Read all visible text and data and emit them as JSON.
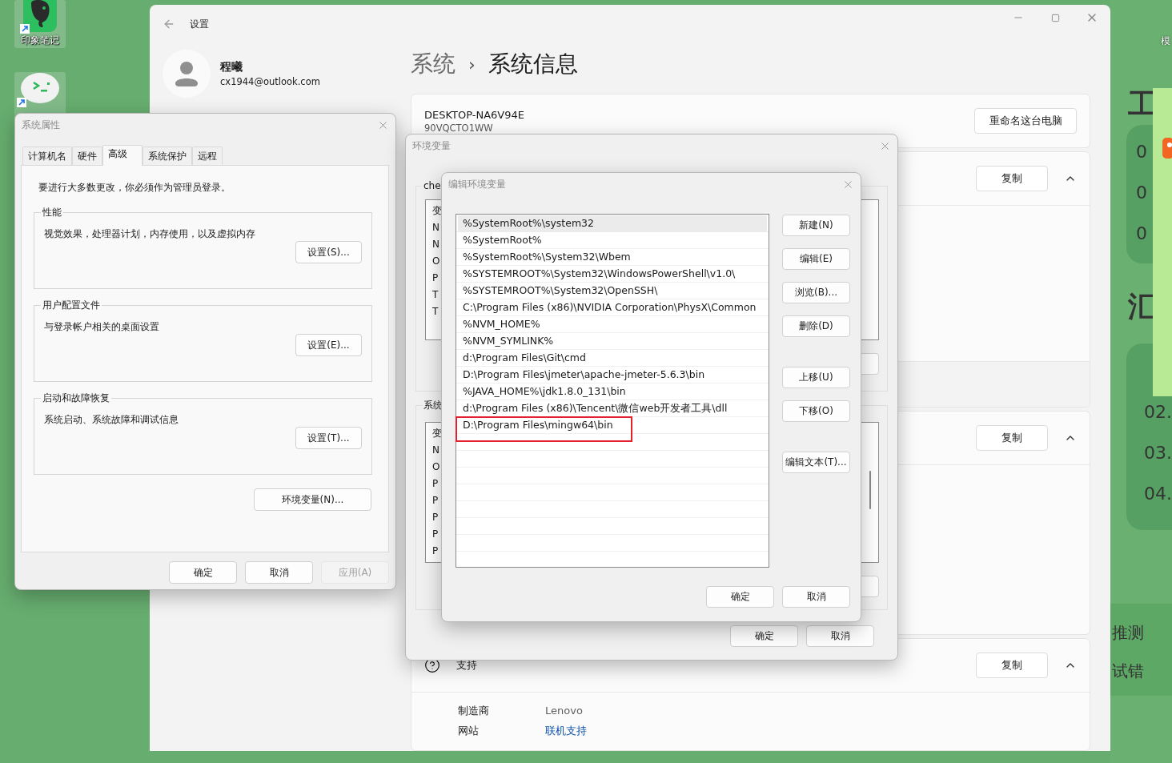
{
  "desktop": {
    "icons": [
      {
        "label": "印象笔记",
        "kind": "notes"
      },
      {
        "kind": "chat"
      }
    ]
  },
  "side_app": {
    "corner_label": "模",
    "title_1": "工",
    "numbers": [
      "0",
      "0",
      "0"
    ],
    "title_2": "汇",
    "steps": [
      "02.",
      "03.",
      "04."
    ],
    "notes": [
      "推测",
      "试错"
    ]
  },
  "settings": {
    "title": "设置",
    "user": {
      "name": "程曦",
      "email": "cx1944@outlook.com"
    },
    "breadcrumb": {
      "parent": "系统",
      "separator": "›",
      "current": "系统信息"
    },
    "device": {
      "name": "DESKTOP-NA6V94E",
      "model": "90VQCTO1WW",
      "rename_button": "重命名这台电脑"
    },
    "sections": [
      {
        "copy_button": "复制",
        "expanded": true
      },
      {
        "copy_button": "复制",
        "expanded": true
      },
      {
        "title": "支持",
        "copy_button": "复制",
        "expanded": true,
        "rows": [
          {
            "label": "制造商",
            "value": "Lenovo",
            "kind": "text"
          },
          {
            "label": "网站",
            "value": "联机支持",
            "kind": "link"
          }
        ]
      }
    ]
  },
  "system_properties": {
    "title": "系统属性",
    "tabs": [
      {
        "label": "计算机名",
        "selected": false
      },
      {
        "label": "硬件",
        "selected": false
      },
      {
        "label": "高级",
        "selected": true
      },
      {
        "label": "系统保护",
        "selected": false
      },
      {
        "label": "远程",
        "selected": false
      }
    ],
    "notice": "要进行大多数更改，你必须作为管理员登录。",
    "groups": [
      {
        "legend": "性能",
        "description": "视觉效果，处理器计划，内存使用，以及虚拟内存",
        "button": "设置(S)..."
      },
      {
        "legend": "用户配置文件",
        "description": "与登录帐户相关的桌面设置",
        "button": "设置(E)..."
      },
      {
        "legend": "启动和故障恢复",
        "description": "系统启动、系统故障和调试信息",
        "button": "设置(T)..."
      }
    ],
    "env_button": "环境变量(N)...",
    "buttons": [
      {
        "label": "确定",
        "disabled": false
      },
      {
        "label": "取消",
        "disabled": false
      },
      {
        "label": "应用(A)",
        "disabled": true
      }
    ]
  },
  "environment_variables": {
    "title": "环境变量",
    "user_group": {
      "legend": "che",
      "rows": [
        "变",
        "N",
        "N",
        "O",
        "P",
        "T",
        "T"
      ]
    },
    "system_group": {
      "legend": "系统",
      "rows": [
        "变",
        "N",
        "O",
        "P",
        "P",
        "P",
        "P",
        "P"
      ]
    },
    "buttons": [
      "确定",
      "取消"
    ]
  },
  "edit_variable": {
    "title": "编辑环境变量",
    "entries": [
      {
        "text": "%SystemRoot%\\system32",
        "selected": true,
        "boxed": false
      },
      {
        "text": "%SystemRoot%",
        "selected": false,
        "boxed": false
      },
      {
        "text": "%SystemRoot%\\System32\\Wbem",
        "selected": false,
        "boxed": false
      },
      {
        "text": "%SYSTEMROOT%\\System32\\WindowsPowerShell\\v1.0\\",
        "selected": false,
        "boxed": false
      },
      {
        "text": "%SYSTEMROOT%\\System32\\OpenSSH\\",
        "selected": false,
        "boxed": false
      },
      {
        "text": "C:\\Program Files (x86)\\NVIDIA Corporation\\PhysX\\Common",
        "selected": false,
        "boxed": false
      },
      {
        "text": "%NVM_HOME%",
        "selected": false,
        "boxed": false
      },
      {
        "text": "%NVM_SYMLINK%",
        "selected": false,
        "boxed": false
      },
      {
        "text": "d:\\Program Files\\Git\\cmd",
        "selected": false,
        "boxed": false
      },
      {
        "text": "D:\\Program Files\\jmeter\\apache-jmeter-5.6.3\\bin",
        "selected": false,
        "boxed": false
      },
      {
        "text": "%JAVA_HOME%\\jdk1.8.0_131\\bin",
        "selected": false,
        "boxed": false
      },
      {
        "text": "d:\\Program Files (x86)\\Tencent\\微信web开发者工具\\dll",
        "selected": false,
        "boxed": false
      },
      {
        "text": "D:\\Program Files\\mingw64\\bin",
        "selected": false,
        "boxed": true
      }
    ],
    "side_button_groups": [
      [
        "新建(N)",
        "编辑(E)",
        "浏览(B)...",
        "删除(D)"
      ],
      [
        "上移(U)",
        "下移(O)"
      ],
      [
        "编辑文本(T)..."
      ]
    ],
    "buttons": [
      "确定",
      "取消"
    ]
  }
}
